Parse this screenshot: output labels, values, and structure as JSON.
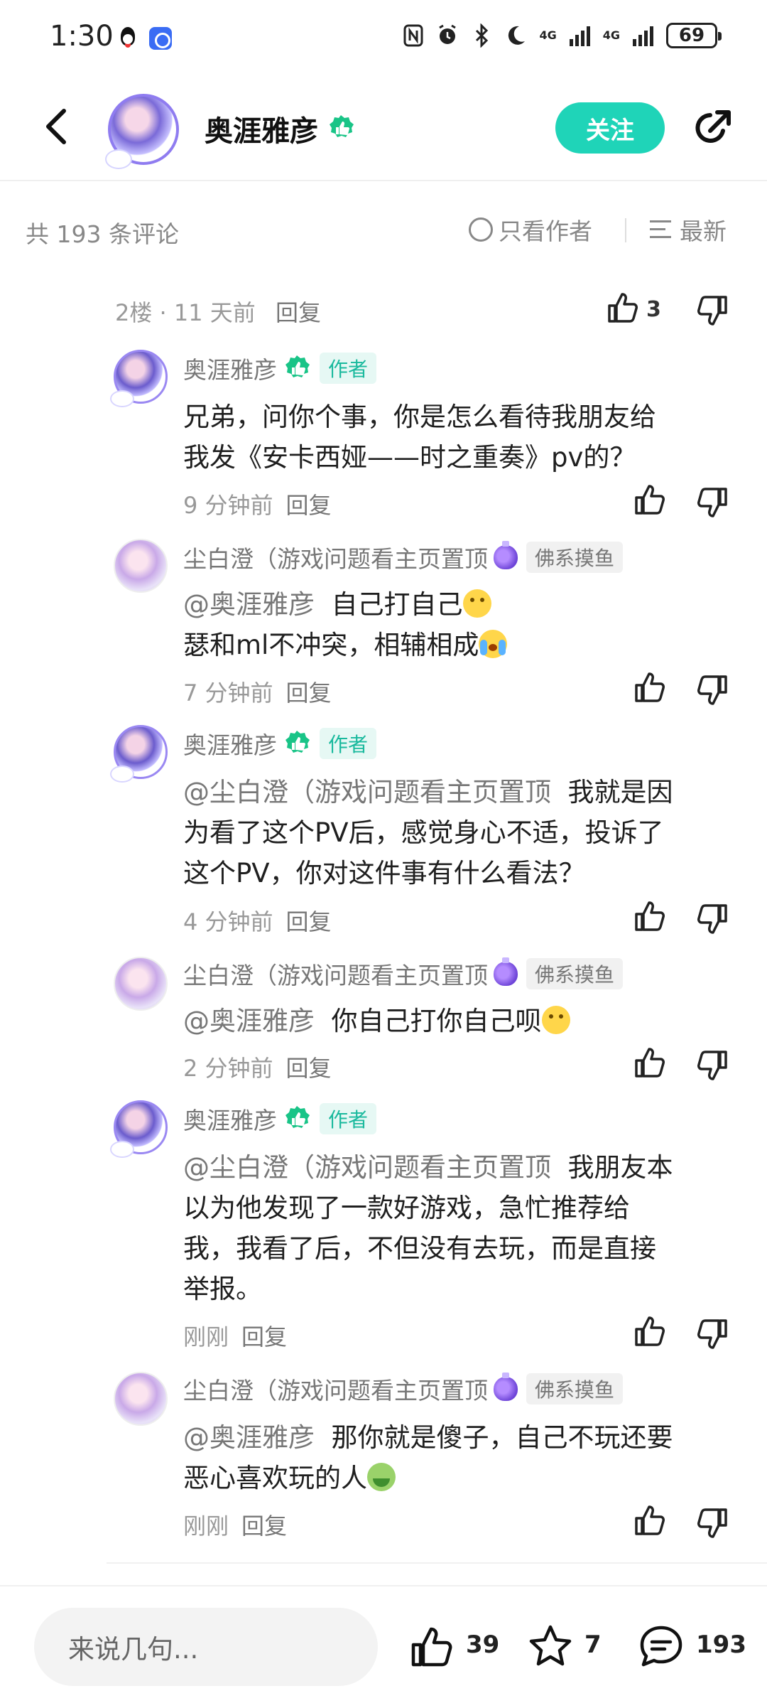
{
  "status_bar": {
    "time": "1:30",
    "battery": "69",
    "network_1": "4G",
    "network_2": "4G",
    "app_icons": [
      "qq-icon",
      "blue-app-icon"
    ],
    "right_icons": [
      "nfc-icon",
      "alarm-icon",
      "bluetooth-icon",
      "do-not-disturb-icon"
    ]
  },
  "header": {
    "author_name": "奥涯雅彦",
    "follow_label": "关注",
    "accent_color": "#1fd4b8"
  },
  "filter_bar": {
    "comment_count_text": "共 193 条评论",
    "only_author_label": "只看作者",
    "sort_label": "最新"
  },
  "parent_comment": {
    "floor": "2楼",
    "separator": "·",
    "time": "11 天前",
    "reply_label": "回复",
    "likes": "3"
  },
  "replies": [
    {
      "name": "奥涯雅彦",
      "tag": "作者",
      "text_lines": [
        "兄弟，问你个事，你是怎么看待我朋友给",
        "我发《安卡西娅——时之重奏》pv的？"
      ],
      "time": "9 分钟前",
      "reply_label": "回复"
    },
    {
      "name": "尘白澄（游戏问题看主页置顶",
      "badge": "佛系摸鱼",
      "mention": "@奥涯雅彦",
      "text_lines": [
        "自己打自己",
        "瑟和ml不冲突，相辅相成"
      ],
      "emoji_1": "smile-emoji",
      "emoji_2": "cry-emoji",
      "time": "7 分钟前",
      "reply_label": "回复"
    },
    {
      "name": "奥涯雅彦",
      "tag": "作者",
      "mention": "@尘白澄（游戏问题看主页置顶",
      "text_lines": [
        "我就是因",
        "为看了这个PV后，感觉身心不适，投诉了",
        "这个PV，你对这件事有什么看法？"
      ],
      "time": "4 分钟前",
      "reply_label": "回复"
    },
    {
      "name": "尘白澄（游戏问题看主页置顶",
      "badge": "佛系摸鱼",
      "mention": "@奥涯雅彦",
      "text_lines": [
        "你自己打你自己呗"
      ],
      "emoji_1": "smile-emoji",
      "time": "2 分钟前",
      "reply_label": "回复"
    },
    {
      "name": "奥涯雅彦",
      "tag": "作者",
      "mention": "@尘白澄（游戏问题看主页置顶",
      "text_lines": [
        "我朋友本",
        "以为他发现了一款好游戏，急忙推荐给",
        "我，我看了后，不但没有去玩，而是直接",
        "举报。"
      ],
      "time": "刚刚",
      "reply_label": "回复"
    },
    {
      "name": "尘白澄（游戏问题看主页置顶",
      "badge": "佛系摸鱼",
      "mention": "@奥涯雅彦",
      "text_lines": [
        "那你就是傻子，自己不玩还要",
        "恶心喜欢玩的人"
      ],
      "emoji_1": "sick-emoji",
      "time": "刚刚",
      "reply_label": "回复"
    }
  ],
  "bottom_bar": {
    "input_placeholder": "来说几句...",
    "like_count": "39",
    "star_count": "7",
    "comment_count": "193"
  }
}
